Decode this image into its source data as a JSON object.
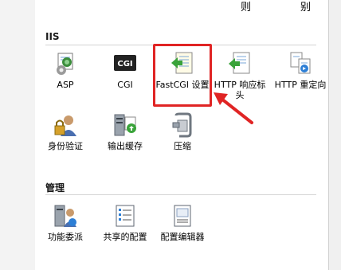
{
  "top_labels": [
    "则",
    "别"
  ],
  "sections": {
    "iis": {
      "title": "IIS",
      "items": [
        {
          "label": "ASP"
        },
        {
          "label": "CGI"
        },
        {
          "label": "FastCGI 设置"
        },
        {
          "label": "HTTP 响应标头"
        },
        {
          "label": "HTTP 重定向"
        },
        {
          "label": "身份验证"
        },
        {
          "label": "输出缓存"
        },
        {
          "label": "压缩"
        }
      ]
    },
    "management": {
      "title": "管理",
      "items": [
        {
          "label": "功能委派"
        },
        {
          "label": "共享的配置"
        },
        {
          "label": "配置编辑器"
        }
      ]
    }
  },
  "cgi_icon_text": "CGI",
  "highlight_color": "#e02424"
}
